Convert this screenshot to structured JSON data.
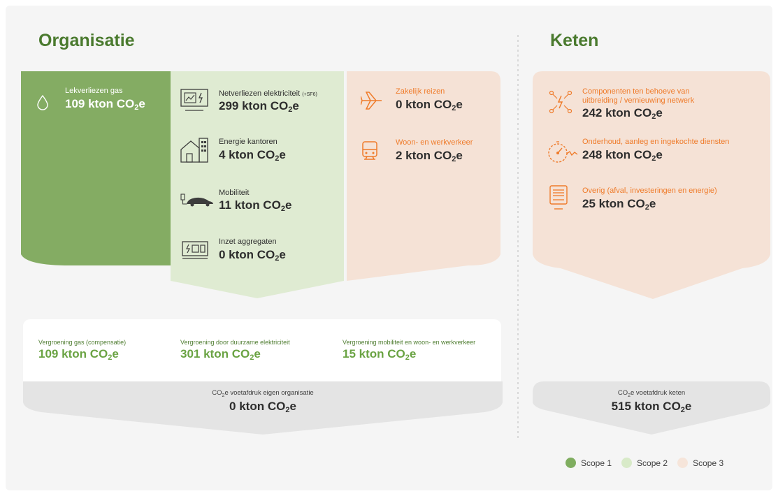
{
  "sections": {
    "organisatie": "Organisatie",
    "keten": "Keten"
  },
  "scope1": {
    "items": [
      {
        "label": "Lekverliezen gas",
        "value": "109 kton CO",
        "suffix": "e"
      }
    ]
  },
  "scope2": {
    "items": [
      {
        "label": "Netverliezen elektriciteit",
        "label_note": "(+SF6)",
        "value": "299 kton CO",
        "suffix": "e"
      },
      {
        "label": "Energie kantoren",
        "value": "4 kton CO",
        "suffix": "e"
      },
      {
        "label": "Mobiliteit",
        "value": "11 kton CO",
        "suffix": "e"
      },
      {
        "label": "Inzet aggregaten",
        "value": "0 kton CO",
        "suffix": "e"
      }
    ]
  },
  "scope3_org": {
    "items": [
      {
        "label": "Zakelijk reizen",
        "value": "0 kton CO",
        "suffix": "e"
      },
      {
        "label": "Woon- en werkverkeer",
        "value": "2 kton CO",
        "suffix": "e"
      }
    ]
  },
  "keten": {
    "items": [
      {
        "label_line1": "Componenten ten behoeve van",
        "label_line2": "uitbreiding / vernieuwing netwerk",
        "value": "242 kton CO",
        "suffix": "e"
      },
      {
        "label": "Onderhoud, aanleg en ingekochte diensten",
        "value": "248 kton CO",
        "suffix": "e"
      },
      {
        "label": "Overig (afval, investeringen en energie)",
        "value": "25 kton CO",
        "suffix": "e"
      }
    ]
  },
  "vergroening": [
    {
      "label": "Vergroening gas (compensatie)",
      "value": "109 kton CO",
      "suffix": "e"
    },
    {
      "label": "Vergroening door duurzame elektriciteit",
      "value": "301 kton CO",
      "suffix": "e"
    },
    {
      "label": "Vergroening mobiliteit en woon- en werkverkeer",
      "value": "15 kton CO",
      "suffix": "e"
    }
  ],
  "footprint_org": {
    "label_pre": "CO",
    "label_post": "e voetafdruk eigen organisatie",
    "value": "0 kton CO",
    "suffix": "e"
  },
  "footprint_keten": {
    "label_pre": "CO",
    "label_post": "e voetafdruk keten",
    "value": "515 kton CO",
    "suffix": "e"
  },
  "subscript_2": "2",
  "legend": [
    {
      "label": "Scope 1",
      "color": "#7fad5f"
    },
    {
      "label": "Scope 2",
      "color": "#d8eac8"
    },
    {
      "label": "Scope 3",
      "color": "#f6e5da"
    }
  ],
  "colors": {
    "scope1": "#84ac63",
    "scope2": "#dfebd2",
    "scope3": "#f5e2d6",
    "accent_green": "#4a7a2e",
    "accent_orange": "#ef7b2a"
  },
  "icons": [
    "drop-icon",
    "grid-loss-icon",
    "office-building-icon",
    "electric-car-icon",
    "generator-icon",
    "airplane-icon",
    "train-icon",
    "components-network-icon",
    "maintenance-icon",
    "other-waste-icon"
  ]
}
